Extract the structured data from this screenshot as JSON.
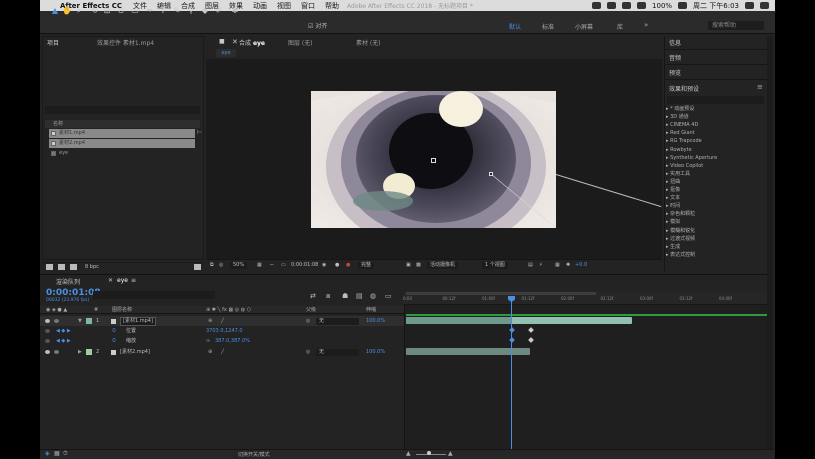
{
  "menubar": {
    "app_name": "After Effects CC",
    "items": [
      "文件",
      "编辑",
      "合成",
      "图层",
      "效果",
      "动画",
      "视图",
      "窗口",
      "帮助"
    ],
    "battery": "100%",
    "clock": "周二 下午6:03"
  },
  "window_title": "Adobe After Effects CC 2018 - 无标题项目 *",
  "toolbar": {
    "snap_label": "对齐",
    "workspaces": [
      "默认",
      "标准",
      "小屏幕",
      "库"
    ],
    "search_placeholder": "搜索帮助"
  },
  "project_panel": {
    "tab_project": "项目",
    "tab_effects_controls": "效果控件 素材1.mp4",
    "column_name": "名称",
    "items": [
      {
        "name": "素材1.mp4",
        "selected": true
      },
      {
        "name": "素材2.mp4",
        "selected": true
      },
      {
        "name": "eye",
        "selected": false
      }
    ],
    "bpc": "8 bpc"
  },
  "viewer": {
    "tab_comp_prefix": "合成",
    "tab_comp_name": "eye",
    "tab_layer": "图层 (无)",
    "tab_footage": "素材 (无)",
    "flow_tab": "eye",
    "zoom": "50%",
    "timecode": "0:00:01:08",
    "resolution": "完整",
    "camera": "活动摄像机",
    "views": "1 个视图",
    "offset": "+0.0"
  },
  "right_panel": {
    "info": "信息",
    "audio": "音频",
    "preview": "预览",
    "effects_presets": "效果和预设",
    "effect_categories": [
      "* 动画预设",
      "3D 通道",
      "CINEMA 4D",
      "Red Giant",
      "RG Trapcode",
      "Rowbyte",
      "Synthetic Aperture",
      "Video Copilot",
      "实用工具",
      "扭曲",
      "抠像",
      "文本",
      "时间",
      "杂色和颗粒",
      "模拟",
      "模糊和锐化",
      "过渡式视频",
      "生成",
      "表达式控制"
    ]
  },
  "timeline": {
    "tab_render": "渲染队列",
    "tab_comp": "eye",
    "timecode": "0:00:01:08",
    "frames": "00032 (23.976 fps)",
    "col_layer_name": "图层名称",
    "col_parent": "父级",
    "col_stretch": "伸缩",
    "layers": [
      {
        "num": "1",
        "name": "[素材1.mp4]",
        "parent": "无",
        "stretch": "100.0%",
        "color": "#7fb7a6"
      },
      {
        "num": "2",
        "name": "[素材2.mp4]",
        "parent": "无",
        "stretch": "100.0%",
        "color": "#9ccfa6"
      }
    ],
    "props": [
      {
        "name": "位置",
        "value": "3703.0,1247.0"
      },
      {
        "name": "缩放",
        "value": "387.0,387.0%"
      }
    ],
    "ruler_ticks": [
      "0:00",
      "00:12f",
      "01:00f",
      "01:12f",
      "02:00f",
      "02:12f",
      "03:00f",
      "03:12f",
      "04:00f"
    ],
    "switch_label": "切换开关/模式"
  }
}
